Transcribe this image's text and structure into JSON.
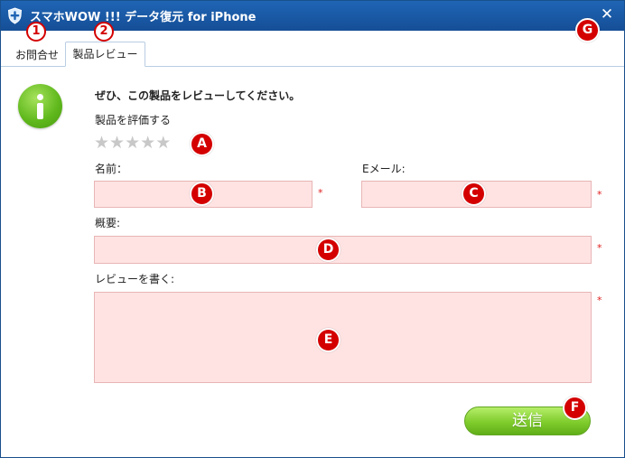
{
  "window": {
    "title": "スマホWOW !!! データ復元 for iPhone",
    "close_glyph": "✕"
  },
  "tabs": [
    {
      "label": "お問合せ"
    },
    {
      "label": "製品レビュー",
      "selected": true
    }
  ],
  "form": {
    "heading": "ぜひ、この製品をレビューしてください。",
    "rating_label": "製品を評価する",
    "rating_stars": 5,
    "rating_value": 0,
    "name_label": "名前：",
    "email_label": "Eメール:",
    "summary_label": "概要:",
    "review_label": "レビューを書く:",
    "name_value": "",
    "email_value": "",
    "summary_value": "",
    "review_value": "",
    "required_mark": "*",
    "submit_label": "送信"
  },
  "annotations": {
    "tab_contact": "1",
    "tab_review": "2",
    "rating": "A",
    "name": "B",
    "email": "C",
    "summary": "D",
    "review": "E",
    "submit": "F",
    "close": "G"
  },
  "colors": {
    "titlebar": "#1a5aa6",
    "field_bg": "#ffe3e3",
    "badge": "#d40000",
    "button_green": "#7fcc2c",
    "star": "#c8c8c8"
  },
  "icons": {
    "app": "shield-plus-icon",
    "info": "info-icon",
    "star": "star-icon"
  }
}
